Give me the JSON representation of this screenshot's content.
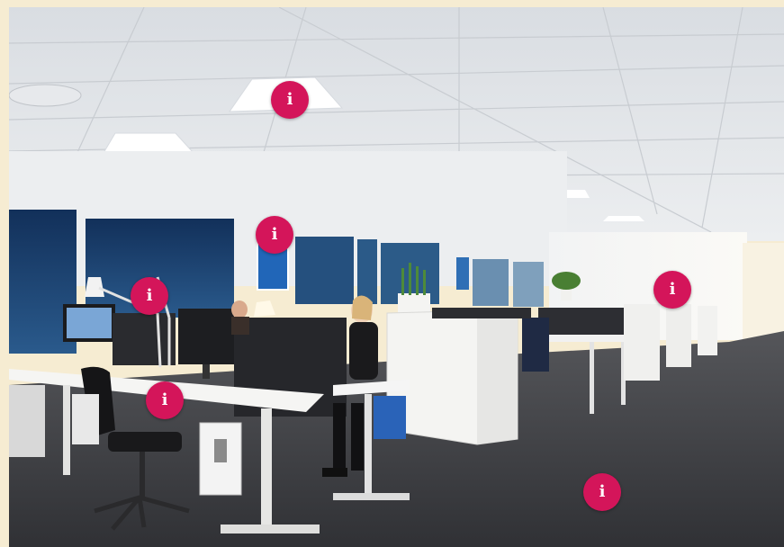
{
  "scene": {
    "icon": "office-photo",
    "hotspot_glyph": "i",
    "hotspot_icon": "info-icon",
    "colors": {
      "hotspot": "#d4155a",
      "page_border": "#f6ecd2",
      "ceiling": "#e4e8ec",
      "wall": "#eef0f2",
      "carpet": "#3b3c40",
      "window": "#1b3a66"
    }
  },
  "hotspots": [
    {
      "id": "ceiling-light"
    },
    {
      "id": "window"
    },
    {
      "id": "desk-lamp"
    },
    {
      "id": "cabinet"
    },
    {
      "id": "desk"
    },
    {
      "id": "carpet"
    }
  ]
}
